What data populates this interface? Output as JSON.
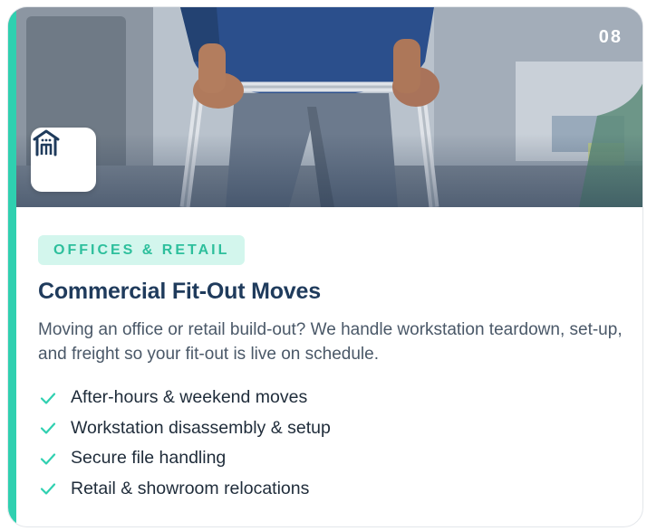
{
  "card": {
    "number": "08",
    "category": "OFFICES & RETAIL",
    "title": "Commercial Fit-Out Moves",
    "description": "Moving an office or retail build-out? We handle workstation teardown, set-up, and freight so your fit-out is live on schedule.",
    "features": [
      "After-hours & weekend moves",
      "Workstation disassembly & setup",
      "Secure file handling",
      "Retail & showroom relocations"
    ],
    "icon": "building-icon",
    "check_icon": "check-icon"
  },
  "colors": {
    "accent": "#2fd0b0",
    "tag_background": "#d3f6ed",
    "tag_text": "#2dbf9c",
    "title": "#1f3b5c",
    "icon": "#1f3b5c"
  }
}
